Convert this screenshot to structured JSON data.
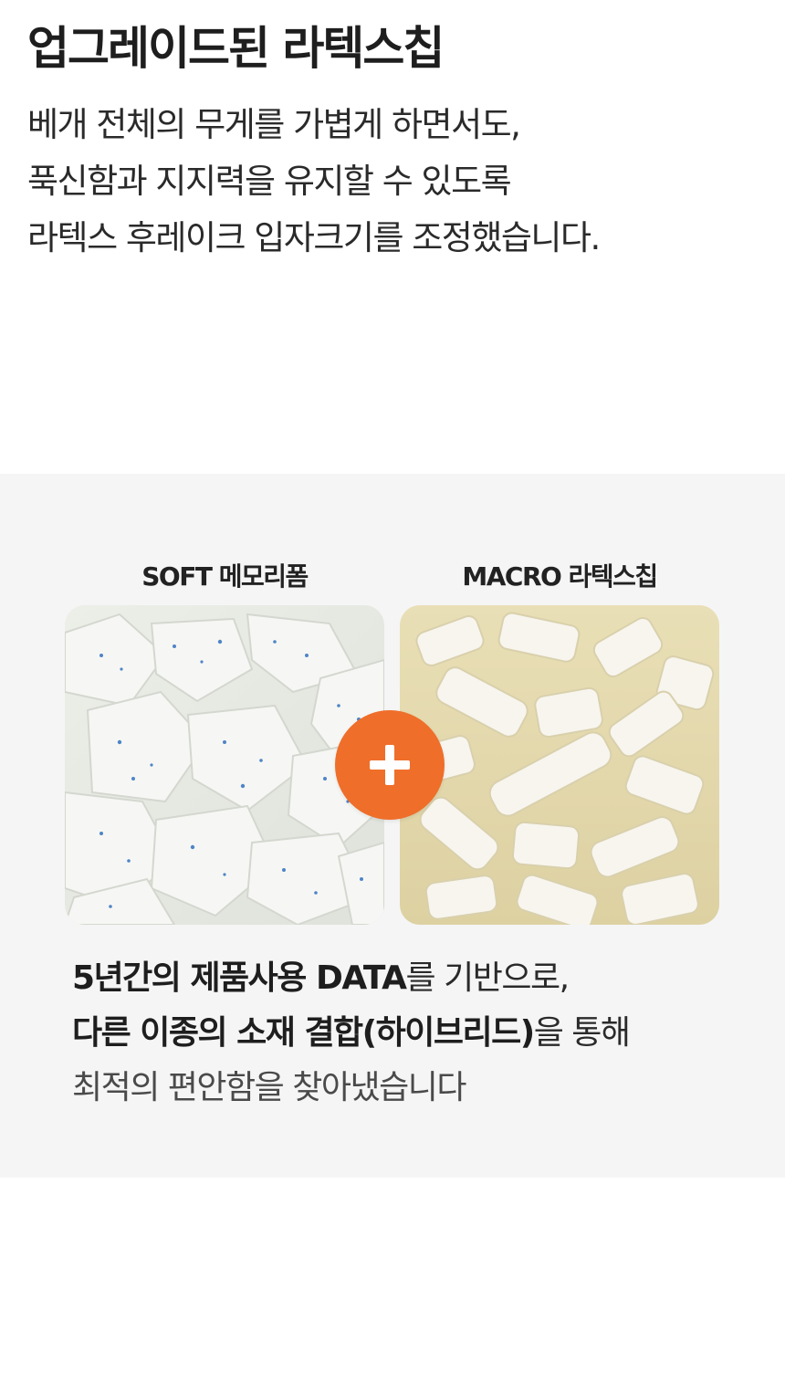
{
  "intro": {
    "title": "업그레이드된 라텍스칩",
    "lines": [
      "베개 전체의 무게를 가볍게 하면서도,",
      "푹신함과 지지력을 유지할 수 있도록",
      "라텍스 후레이크 입자크기를 조정했습니다."
    ]
  },
  "materials": {
    "left": {
      "label": "SOFT 메모리폼",
      "image": "memory-foam-chips-photo"
    },
    "right": {
      "label": "MACRO 라텍스칩",
      "image": "latex-chips-photo"
    },
    "combine_icon": "plus-icon",
    "accent_color": "#ef6e2a"
  },
  "summary": {
    "line1_bold": "5년간의 제품사용 DATA",
    "line1_rest": "를 기반으로,",
    "line2_bold": "다른 이종의 소재 결합(하이브리드)",
    "line2_rest": "을 통해",
    "line3": "최적의 편안함을 찾아냈습니다"
  }
}
